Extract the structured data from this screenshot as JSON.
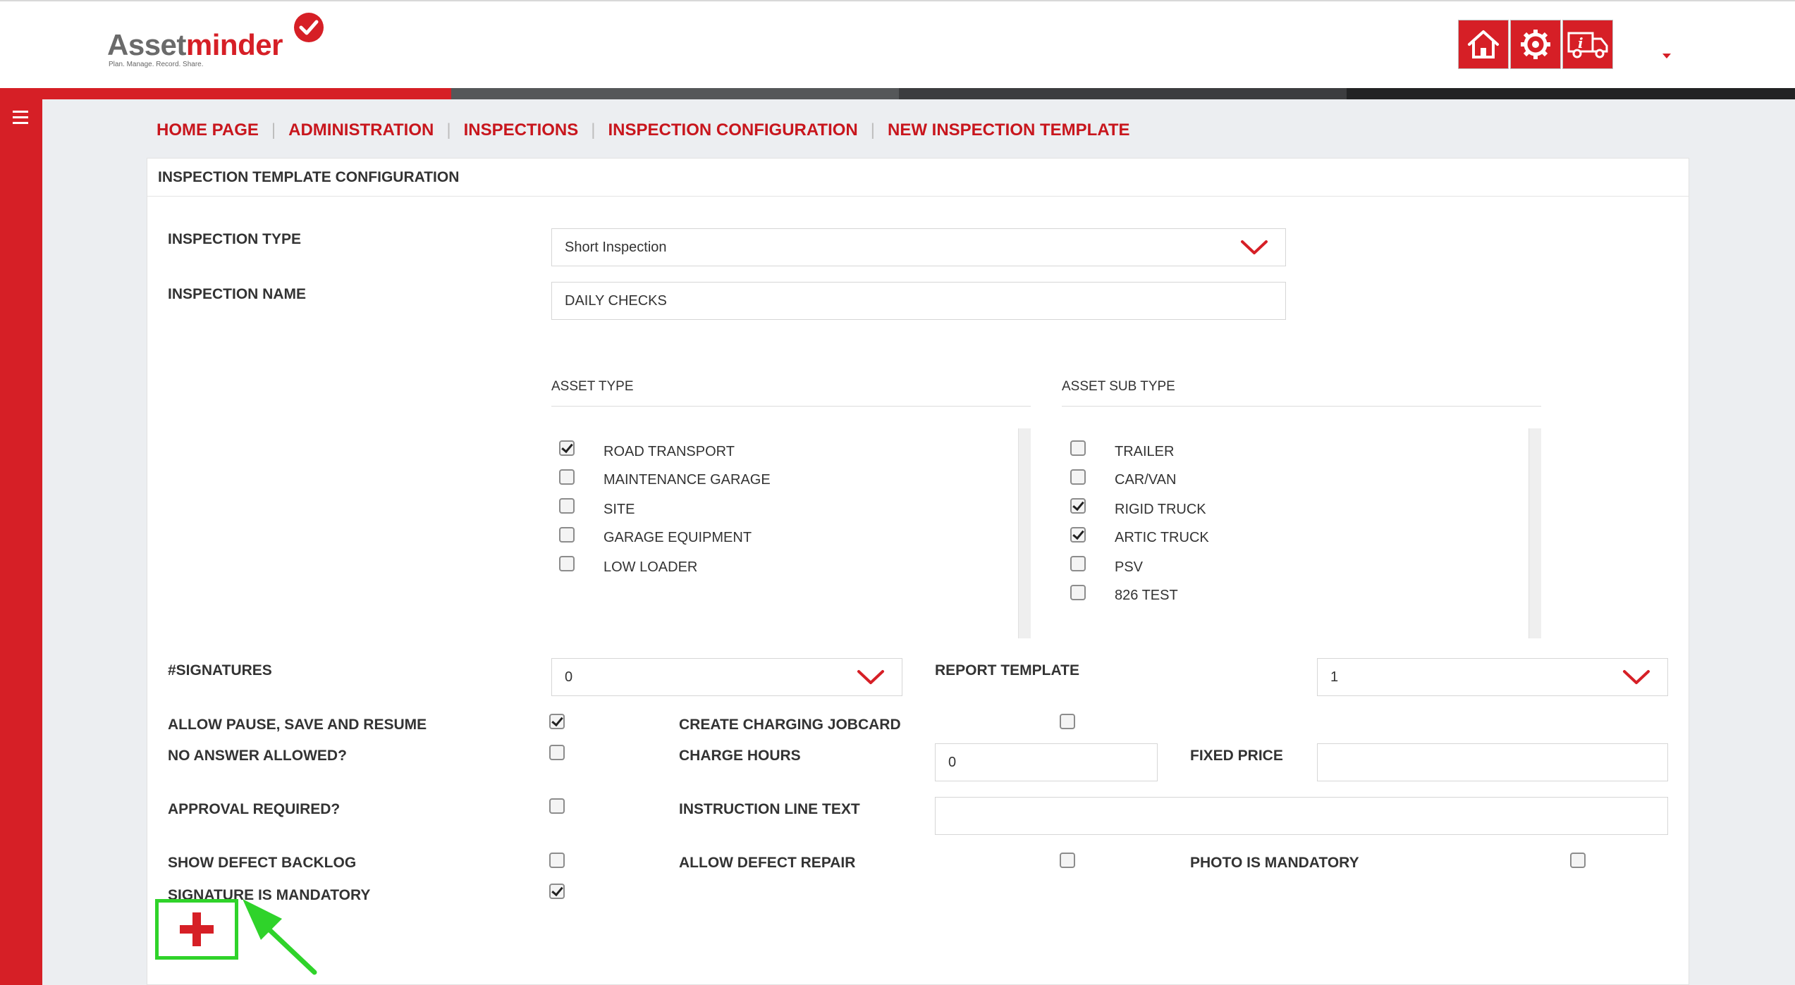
{
  "header": {
    "logo": {
      "word_part1": "Asset",
      "word_part2": "minder",
      "tagline": "Plan. Manage. Record. Share."
    },
    "buttons": {
      "home_icon": "home-icon",
      "settings_icon": "gear-icon",
      "truck_icon": "truck-info-icon"
    },
    "accent": "#d61f26"
  },
  "breadcrumb": {
    "items": [
      "HOME PAGE",
      "ADMINISTRATION",
      "INSPECTIONS",
      "INSPECTION CONFIGURATION",
      "NEW INSPECTION TEMPLATE"
    ],
    "separator": "|"
  },
  "panel": {
    "title": "INSPECTION TEMPLATE CONFIGURATION",
    "inspection_type": {
      "label": "INSPECTION TYPE",
      "value": "Short Inspection"
    },
    "inspection_name": {
      "label": "INSPECTION NAME",
      "value": "DAILY CHECKS"
    },
    "asset_type": {
      "header": "ASSET TYPE",
      "items": [
        {
          "label": "ROAD TRANSPORT",
          "checked": true
        },
        {
          "label": "MAINTENANCE GARAGE",
          "checked": false
        },
        {
          "label": "SITE",
          "checked": false
        },
        {
          "label": "GARAGE EQUIPMENT",
          "checked": false
        },
        {
          "label": "LOW LOADER",
          "checked": false
        }
      ]
    },
    "asset_sub_type": {
      "header": "ASSET SUB TYPE",
      "items": [
        {
          "label": "TRAILER",
          "checked": false
        },
        {
          "label": "CAR/VAN",
          "checked": false
        },
        {
          "label": "RIGID TRUCK",
          "checked": true
        },
        {
          "label": "ARTIC TRUCK",
          "checked": true
        },
        {
          "label": "PSV",
          "checked": false
        },
        {
          "label": "826 TEST",
          "checked": false
        }
      ]
    },
    "signatures": {
      "label": "#SIGNATURES",
      "value": "0"
    },
    "report_template": {
      "label": "REPORT TEMPLATE",
      "value": "1"
    },
    "allow_pause": {
      "label": "ALLOW PAUSE, SAVE AND RESUME",
      "checked": true
    },
    "create_charging_jobcard": {
      "label": "CREATE CHARGING JOBCARD",
      "checked": false
    },
    "no_answer_allowed": {
      "label": "NO ANSWER ALLOWED?",
      "checked": false
    },
    "charge_hours": {
      "label": "CHARGE HOURS",
      "value": "0"
    },
    "fixed_price": {
      "label": "FIXED PRICE",
      "value": ""
    },
    "approval_required": {
      "label": "APPROVAL REQUIRED?",
      "checked": false
    },
    "instruction_line_text": {
      "label": "INSTRUCTION LINE TEXT",
      "value": ""
    },
    "show_defect_backlog": {
      "label": "SHOW DEFECT BACKLOG",
      "checked": false
    },
    "allow_defect_repair": {
      "label": "ALLOW DEFECT REPAIR",
      "checked": false
    },
    "photo_is_mandatory": {
      "label": "PHOTO IS MANDATORY",
      "checked": false
    },
    "signature_is_mandatory": {
      "label": "SIGNATURE IS MANDATORY",
      "checked": true
    },
    "add_button_icon": "plus-icon"
  },
  "annotation": {
    "highlight_color": "#2fd32a"
  }
}
